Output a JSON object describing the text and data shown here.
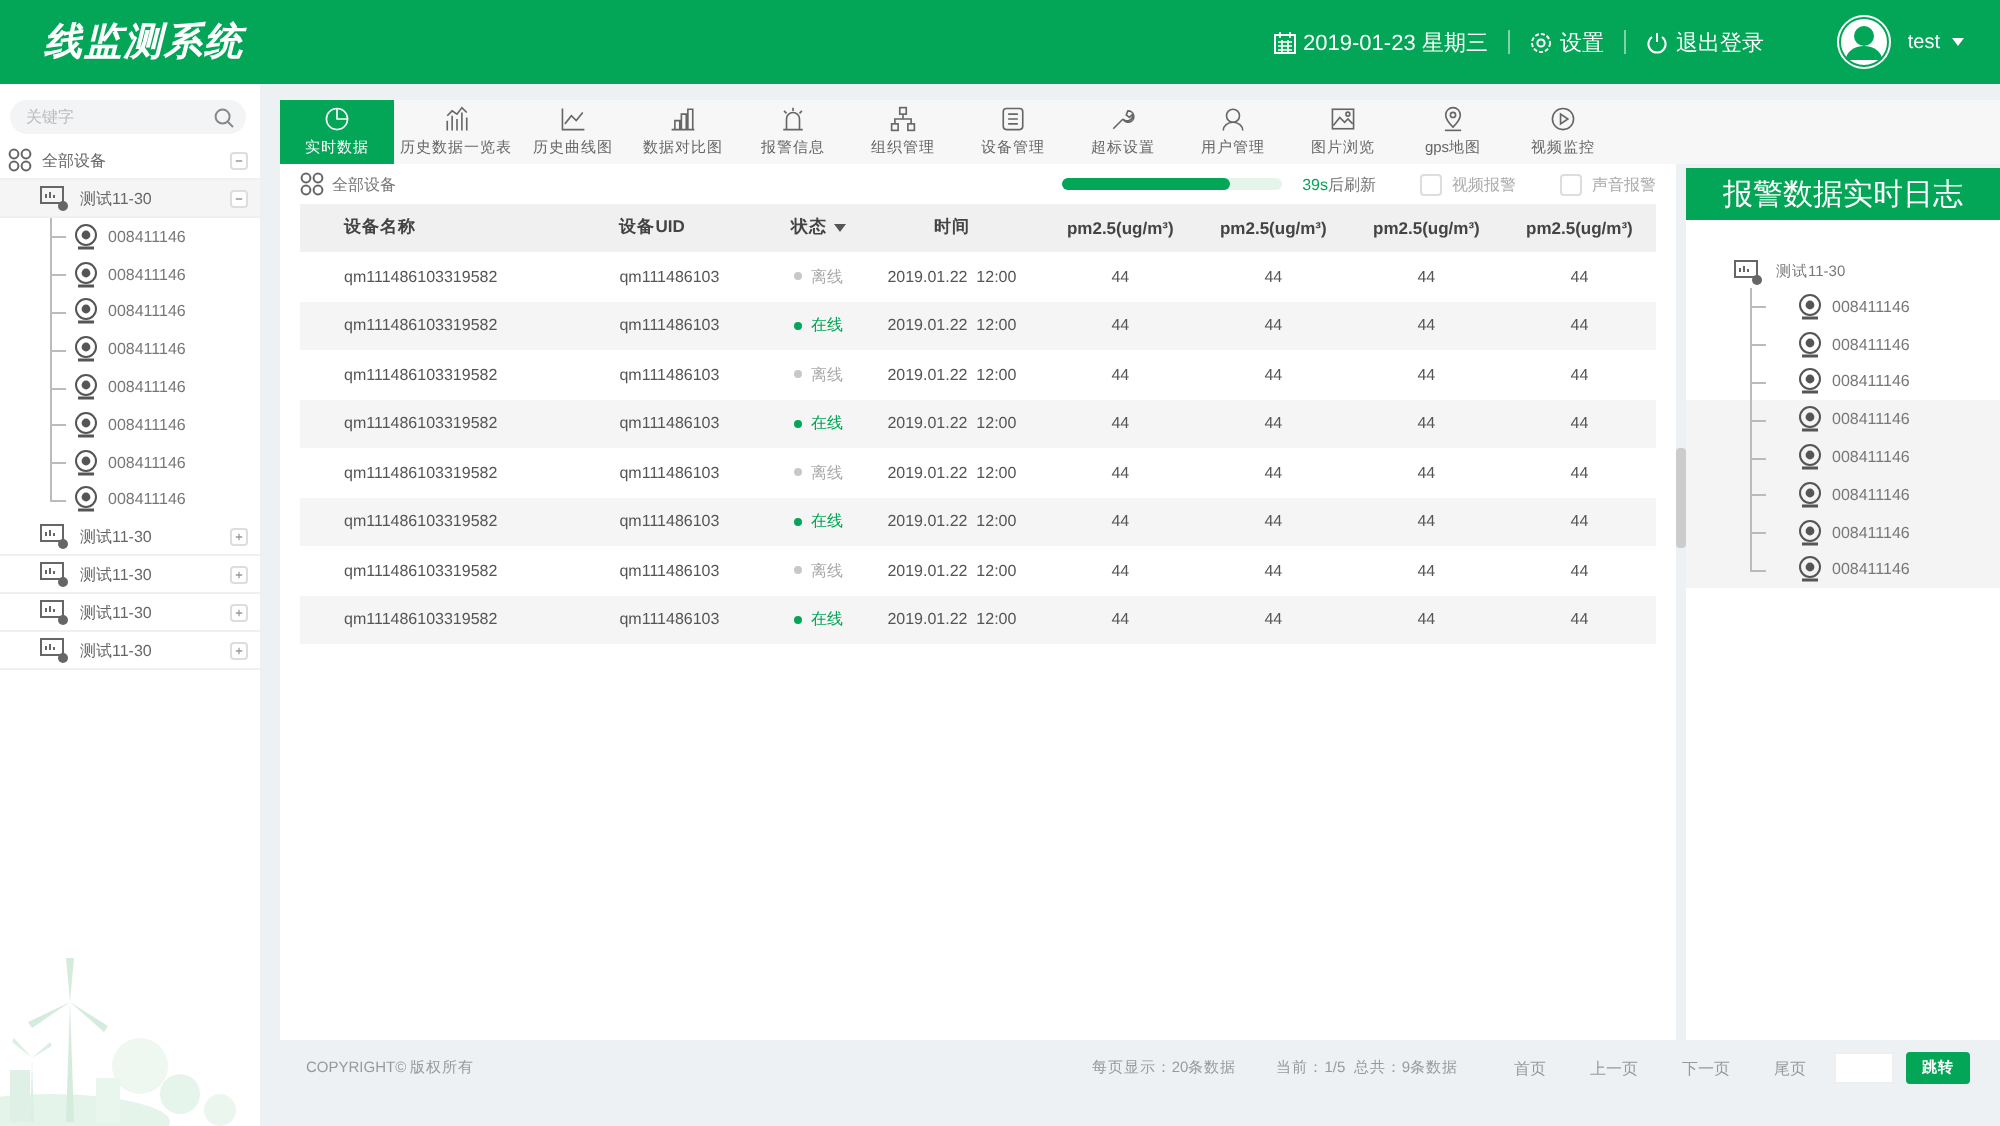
{
  "header": {
    "title": "线监测系统",
    "date": "2019-01-23 星期三",
    "settings": "设置",
    "logout": "退出登录",
    "user": "test"
  },
  "sidebar": {
    "search_placeholder": "关键字",
    "root": {
      "label": "全部设备",
      "expanded": true
    },
    "groups": [
      {
        "label": "测试11-30",
        "expanded": true,
        "children": [
          {
            "label": "008411146"
          },
          {
            "label": "008411146"
          },
          {
            "label": "008411146"
          },
          {
            "label": "008411146"
          },
          {
            "label": "008411146"
          },
          {
            "label": "008411146"
          },
          {
            "label": "008411146"
          },
          {
            "label": "008411146"
          }
        ]
      },
      {
        "label": "测试11-30",
        "expanded": false
      },
      {
        "label": "测试11-30",
        "expanded": false
      },
      {
        "label": "测试11-30",
        "expanded": false
      },
      {
        "label": "测试11-30",
        "expanded": false
      }
    ]
  },
  "tabs": [
    {
      "label": "实时数据",
      "selected": true
    },
    {
      "label": "历史数据一览表",
      "selected": false
    },
    {
      "label": "历史曲线图",
      "selected": false
    },
    {
      "label": "数据对比图",
      "selected": false
    },
    {
      "label": "报警信息",
      "selected": false
    },
    {
      "label": "组织管理",
      "selected": false
    },
    {
      "label": "设备管理",
      "selected": false
    },
    {
      "label": "超标设置",
      "selected": false
    },
    {
      "label": "用户管理",
      "selected": false
    },
    {
      "label": "图片浏览",
      "selected": false
    },
    {
      "label": "gps地图",
      "selected": false
    },
    {
      "label": "视频监控",
      "selected": false
    }
  ],
  "toolbar": {
    "all_devices": "全部设备",
    "refresh": {
      "level": 0.76,
      "seconds": "39s",
      "label": "后刷新"
    },
    "checks": [
      {
        "label": "视频报警",
        "checked": false
      },
      {
        "label": "声音报警",
        "checked": false
      }
    ]
  },
  "table": {
    "columns": [
      "设备名称",
      "设备UID",
      "状态",
      "时间",
      "pm2.5(ug/m³)",
      "pm2.5(ug/m³)",
      "pm2.5(ug/m³)",
      "pm2.5(ug/m³)"
    ],
    "rows": [
      {
        "name": "qm111486103319582",
        "uid": "qm111486103",
        "status": "离线",
        "online": false,
        "time": "2019.01.22  12:00",
        "values": [
          "44",
          "44",
          "44",
          "44"
        ]
      },
      {
        "name": "qm111486103319582",
        "uid": "qm111486103",
        "status": "在线",
        "online": true,
        "time": "2019.01.22  12:00",
        "values": [
          "44",
          "44",
          "44",
          "44"
        ]
      },
      {
        "name": "qm111486103319582",
        "uid": "qm111486103",
        "status": "离线",
        "online": false,
        "time": "2019.01.22  12:00",
        "values": [
          "44",
          "44",
          "44",
          "44"
        ]
      },
      {
        "name": "qm111486103319582",
        "uid": "qm111486103",
        "status": "在线",
        "online": true,
        "time": "2019.01.22  12:00",
        "values": [
          "44",
          "44",
          "44",
          "44"
        ]
      },
      {
        "name": "qm111486103319582",
        "uid": "qm111486103",
        "status": "离线",
        "online": false,
        "time": "2019.01.22  12:00",
        "values": [
          "44",
          "44",
          "44",
          "44"
        ]
      },
      {
        "name": "qm111486103319582",
        "uid": "qm111486103",
        "status": "在线",
        "online": true,
        "time": "2019.01.22  12:00",
        "values": [
          "44",
          "44",
          "44",
          "44"
        ]
      },
      {
        "name": "qm111486103319582",
        "uid": "qm111486103",
        "status": "离线",
        "online": false,
        "time": "2019.01.22  12:00",
        "values": [
          "44",
          "44",
          "44",
          "44"
        ]
      },
      {
        "name": "qm111486103319582",
        "uid": "qm111486103",
        "status": "在线",
        "online": true,
        "time": "2019.01.22  12:00",
        "values": [
          "44",
          "44",
          "44",
          "44"
        ]
      }
    ]
  },
  "log_panel": {
    "title": "报警数据实时日志",
    "group": "测试11-30",
    "children": [
      {
        "label": "008411146",
        "highlighted": false
      },
      {
        "label": "008411146",
        "highlighted": false
      },
      {
        "label": "008411146",
        "highlighted": false
      },
      {
        "label": "008411146",
        "highlighted": true
      },
      {
        "label": "008411146",
        "highlighted": true
      },
      {
        "label": "008411146",
        "highlighted": true
      },
      {
        "label": "008411146",
        "highlighted": true
      },
      {
        "label": "008411146",
        "highlighted": true
      }
    ]
  },
  "footer": {
    "copyright": "COPYRIGHT© 版权所有",
    "per_page": "每页显示：20条数据",
    "summary": "当前：1/5  总共：9条数据",
    "pages": [
      "首页",
      "上一页",
      "下一页",
      "尾页"
    ],
    "jump": "跳转"
  }
}
